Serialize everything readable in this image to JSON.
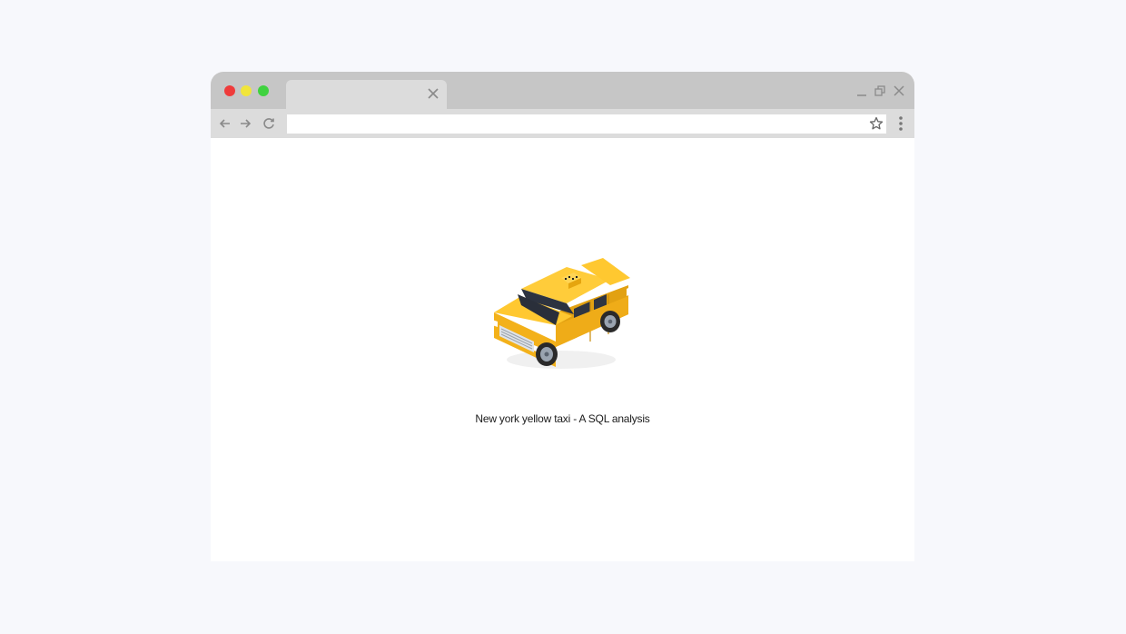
{
  "window": {
    "tab_title": "",
    "address_value": ""
  },
  "icons": {
    "tab_close": "close-icon",
    "minimize": "minimize-icon",
    "restore": "restore-icon",
    "close": "close-icon",
    "back": "arrow-left-icon",
    "forward": "arrow-right-icon",
    "reload": "reload-icon",
    "bookmark": "star-icon",
    "menu": "kebab-menu-icon"
  },
  "content": {
    "caption": "New york yellow taxi - A SQL analysis",
    "illustration": "yellow-taxi-illustration"
  },
  "colors": {
    "page_bg": "#f7f8fc",
    "titlebar": "#c6c6c6",
    "toolbar": "#dcdcdc",
    "taxi_yellow": "#f6b91c"
  }
}
